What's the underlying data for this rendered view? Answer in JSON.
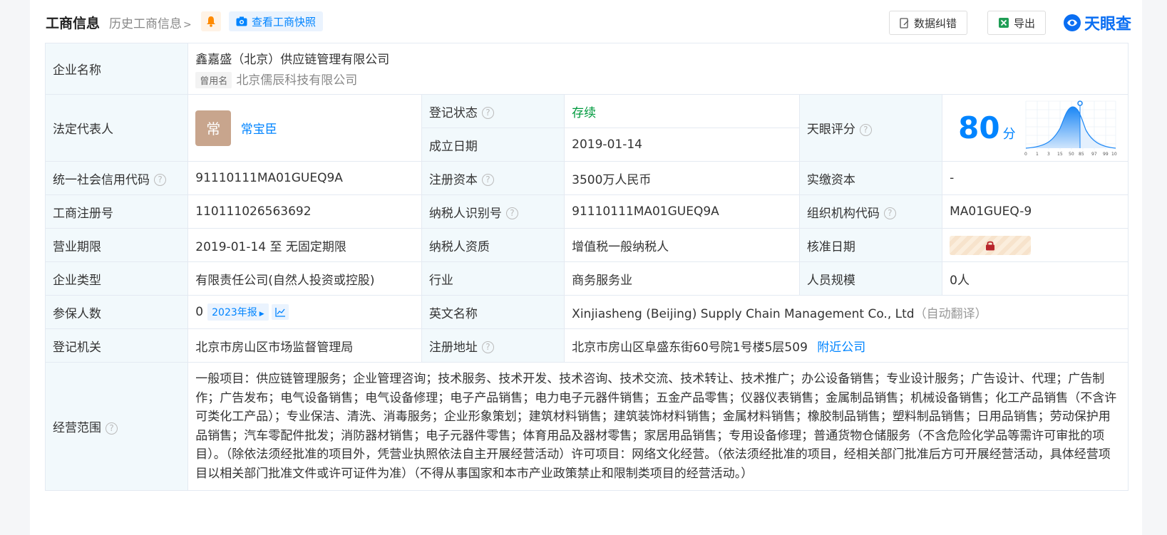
{
  "header": {
    "title": "工商信息",
    "history_link": "历史工商信息",
    "snapshot_button": "查看工商快照",
    "correction_button": "数据纠错",
    "export_button": "导出",
    "brand": "天眼查"
  },
  "table": {
    "company_name_label": "企业名称",
    "company_name": "鑫嘉盛（北京）供应链管理有限公司",
    "former_name_tag": "曾用名",
    "former_name": "北京儒辰科技有限公司",
    "legal_rep_label": "法定代表人",
    "legal_rep_avatar": "常",
    "legal_rep": "常宝臣",
    "reg_status_label": "登记状态",
    "reg_status": "存续",
    "found_date_label": "成立日期",
    "found_date": "2019-01-14",
    "tianyan_score_label": "天眼评分",
    "score": "80",
    "score_unit": "分",
    "score_axis": [
      "0",
      "1",
      "3",
      "15",
      "50",
      "85",
      "97",
      "99",
      "100"
    ],
    "credit_code_label": "统一社会信用代码",
    "credit_code": "91110111MA01GUEQ9A",
    "reg_capital_label": "注册资本",
    "reg_capital": "3500万人民币",
    "paid_capital_label": "实缴资本",
    "paid_capital": "-",
    "biz_reg_no_label": "工商注册号",
    "biz_reg_no": "110111026563692",
    "taxpayer_id_label": "纳税人识别号",
    "taxpayer_id": "91110111MA01GUEQ9A",
    "org_code_label": "组织机构代码",
    "org_code": "MA01GUEQ-9",
    "biz_term_label": "营业期限",
    "biz_term": "2019-01-14 至 无固定期限",
    "taxpayer_quality_label": "纳税人资质",
    "taxpayer_quality": "增值税一般纳税人",
    "approval_date_label": "核准日期",
    "company_type_label": "企业类型",
    "company_type": "有限责任公司(自然人投资或控股)",
    "industry_label": "行业",
    "industry": "商务服务业",
    "staff_size_label": "人员规模",
    "staff_size": "0人",
    "insured_label": "参保人数",
    "insured": "0",
    "insured_year": "2023年报",
    "english_name_label": "英文名称",
    "english_name": "Xinjiasheng (Beijing) Supply Chain Management Co., Ltd",
    "english_name_note": "（自动翻译）",
    "reg_authority_label": "登记机关",
    "reg_authority": "北京市房山区市场监督管理局",
    "reg_address_label": "注册地址",
    "reg_address": "北京市房山区阜盛东街60号院1号楼5层509",
    "nearby_link": "附近公司",
    "scope_label": "经营范围",
    "scope": "一般项目：供应链管理服务；企业管理咨询；技术服务、技术开发、技术咨询、技术交流、技术转让、技术推广；办公设备销售；专业设计服务；广告设计、代理；广告制作；广告发布；电气设备销售；电气设备修理；电子产品销售；电力电子元器件销售；五金产品零售；仪器仪表销售；金属制品销售；机械设备销售；化工产品销售（不含许可类化工产品）；专业保洁、清洗、消毒服务；企业形象策划；建筑材料销售；建筑装饰材料销售；金属材料销售；橡胶制品销售；塑料制品销售；日用品销售；劳动保护用品销售；汽车零配件批发；消防器材销售；电子元器件零售；体育用品及器材零售；家居用品销售；专用设备修理；普通货物仓储服务（不含危险化学品等需许可审批的项目）。（除依法须经批准的项目外，凭营业执照依法自主开展经营活动）许可项目：网络文化经营。（依法须经批准的项目，经相关部门批准后方可开展经营活动，具体经营项目以相关部门批准文件或许可证件为准）（不得从事国家和本市产业政策禁止和限制类项目的经营活动。）"
  },
  "colors": {
    "accent": "#0084ff",
    "label_bg": "#f2f9fc",
    "status_green": "#009a3e"
  }
}
